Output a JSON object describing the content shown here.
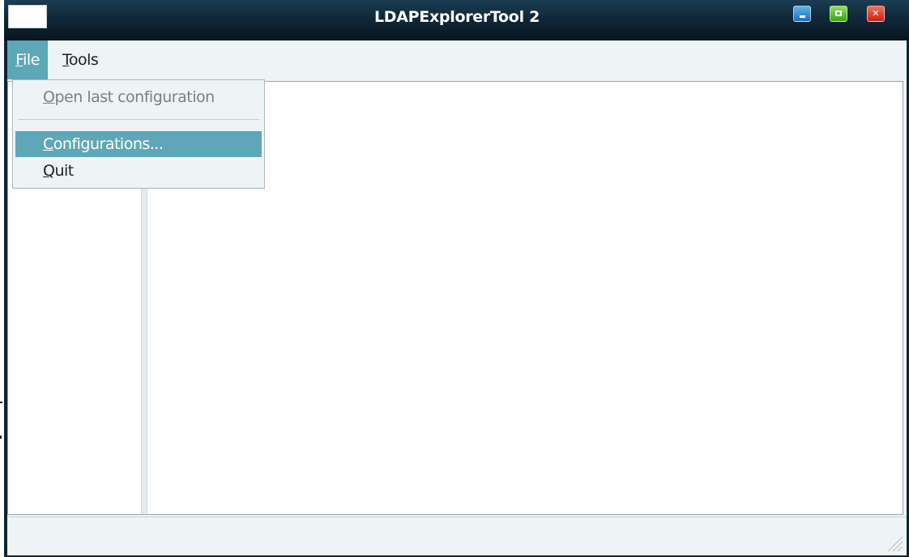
{
  "window": {
    "title": "LDAPExplorerTool 2"
  },
  "menubar": {
    "file": {
      "underline": "F",
      "rest": "ile"
    },
    "tools": {
      "underline": "T",
      "rest": "ools"
    }
  },
  "file_menu": {
    "items": [
      {
        "underline": "O",
        "rest": "pen last configuration",
        "state": "disabled"
      },
      {
        "underline": "C",
        "rest": "onfigurations...",
        "state": "selected"
      },
      {
        "underline": "Q",
        "rest": "uit",
        "state": "normal"
      }
    ]
  },
  "icons": {
    "minimize": "minimize-icon",
    "maximize": "maximize-icon",
    "close": "close-icon",
    "resize": "size-grip-icon"
  },
  "colors": {
    "titlebar": "#112a3b",
    "menu_highlight": "#5ea7b7",
    "menubar_bg": "#eef3f6"
  }
}
